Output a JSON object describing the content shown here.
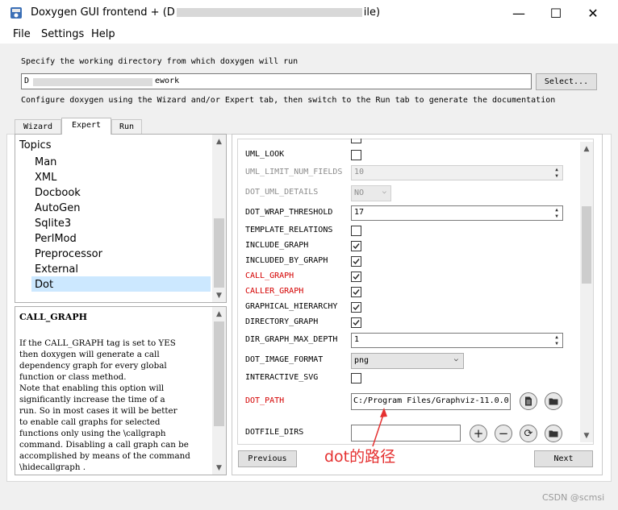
{
  "window": {
    "title": "Doxygen GUI frontend + (D",
    "title_tail": "ile)",
    "minimize": "—",
    "maximize": "☐",
    "close": "✕"
  },
  "menu": [
    "File",
    "Settings",
    "Help"
  ],
  "header": {
    "workdir_prompt": "Specify the working directory from which doxygen will run",
    "workdir_value_start": "D",
    "workdir_value_end": "ework",
    "select_button": "Select...",
    "configure_hint": "Configure doxygen using the Wizard and/or Expert tab, then switch to the Run tab to generate the documentation"
  },
  "tabs": [
    {
      "label": "Wizard",
      "active": false
    },
    {
      "label": "Expert",
      "active": true
    },
    {
      "label": "Run",
      "active": false
    }
  ],
  "topics": {
    "header": "Topics",
    "items": [
      "Man",
      "XML",
      "Docbook",
      "AutoGen",
      "Sqlite3",
      "PerlMod",
      "Preprocessor",
      "External",
      "Dot"
    ],
    "selected": "Dot"
  },
  "help": {
    "title": "CALL_GRAPH",
    "body": "If the CALL_GRAPH tag is set to YES\nthen doxygen will generate a call\ndependency graph for every global\nfunction or class method.\nNote that enabling this option will\nsignificantly increase the time of a\nrun. So in most cases it will be better\nto enable call graphs for selected\nfunctions only using the \\callgraph\ncommand. Disabling a call graph can be\naccomplished by means of the command\n\\hidecallgraph ."
  },
  "options": [
    {
      "label": "UML_LOOK",
      "type": "checkbox",
      "checked": false
    },
    {
      "label": "UML_LIMIT_NUM_FIELDS",
      "type": "spin",
      "value": "10",
      "disabled": true
    },
    {
      "label": "DOT_UML_DETAILS",
      "type": "combo",
      "value": "NO",
      "disabled": true
    },
    {
      "label": "DOT_WRAP_THRESHOLD",
      "type": "spin",
      "value": "17"
    },
    {
      "label": "TEMPLATE_RELATIONS",
      "type": "checkbox",
      "checked": false
    },
    {
      "label": "INCLUDE_GRAPH",
      "type": "checkbox",
      "checked": true
    },
    {
      "label": "INCLUDED_BY_GRAPH",
      "type": "checkbox",
      "checked": true
    },
    {
      "label": "CALL_GRAPH",
      "type": "checkbox",
      "checked": true,
      "modified": true
    },
    {
      "label": "CALLER_GRAPH",
      "type": "checkbox",
      "checked": true,
      "modified": true
    },
    {
      "label": "GRAPHICAL_HIERARCHY",
      "type": "checkbox",
      "checked": true
    },
    {
      "label": "DIRECTORY_GRAPH",
      "type": "checkbox",
      "checked": true
    },
    {
      "label": "DIR_GRAPH_MAX_DEPTH",
      "type": "spin",
      "value": "1"
    },
    {
      "label": "DOT_IMAGE_FORMAT",
      "type": "combo",
      "value": "png"
    },
    {
      "label": "INTERACTIVE_SVG",
      "type": "checkbox",
      "checked": false
    },
    {
      "label": "DOT_PATH",
      "type": "path",
      "value": "C:/Program Files/Graphviz-11.0.0-",
      "modified": true
    },
    {
      "label": "DOTFILE_DIRS",
      "type": "list",
      "value": ""
    }
  ],
  "nav": {
    "previous": "Previous",
    "next": "Next"
  },
  "annotation": "dot的路径",
  "watermark": "CSDN @scmsi",
  "colors": {
    "modified": "#d40000",
    "annotation": "#e53030",
    "selected_topic": "#cce8ff"
  }
}
